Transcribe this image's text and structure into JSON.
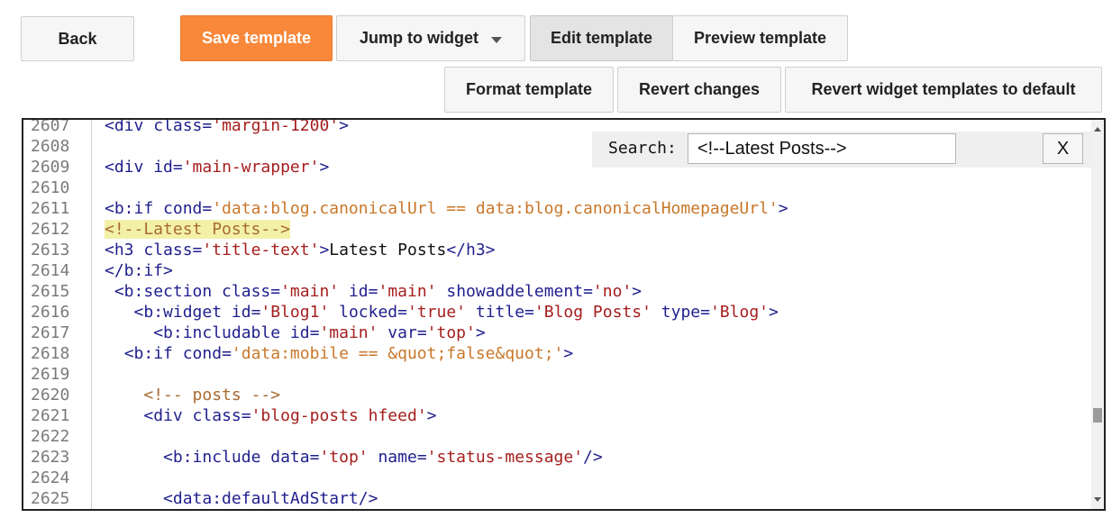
{
  "toolbar": {
    "back": "Back",
    "save": "Save template",
    "jump": "Jump to widget",
    "edit": "Edit template",
    "preview": "Preview template",
    "format": "Format template",
    "revert": "Revert changes",
    "revert_widgets": "Revert widget templates to default"
  },
  "search": {
    "label": "Search:",
    "value": "<!--Latest Posts-->",
    "close": "X"
  },
  "code": {
    "line_numbers": [
      "2607",
      "2608",
      "2609",
      "2610",
      "2611",
      "2612",
      "2613",
      "2614",
      "2615",
      "2616",
      "2617",
      "2618",
      "2619",
      "2620",
      "2621",
      "2622",
      "2623",
      "2624",
      "2625"
    ],
    "highlight_line": "2612",
    "tokens": {
      "l2607": [
        "<div",
        " class",
        "=",
        "'margin-1200'",
        ">"
      ],
      "l2609": [
        "<div",
        " id",
        "=",
        "'main-wrapper'",
        ">"
      ],
      "l2611": [
        "<b:if",
        " cond",
        "=",
        "'data:blog.canonicalUrl == data:blog.canonicalHomepageUrl'",
        ">"
      ],
      "l2612": [
        "<!--Latest Posts-->"
      ],
      "l2613": [
        "<h3",
        " class",
        "=",
        "'title-text'",
        ">",
        "Latest Posts",
        "</h3>"
      ],
      "l2614": [
        "</b:if>"
      ],
      "l2615": [
        " ",
        "<b:section",
        " class",
        "=",
        "'main'",
        " id",
        "=",
        "'main'",
        " showaddelement",
        "=",
        "'no'",
        ">"
      ],
      "l2616": [
        "   ",
        "<b:widget",
        " id",
        "=",
        "'Blog1'",
        " locked",
        "=",
        "'true'",
        " title",
        "=",
        "'Blog Posts'",
        " type",
        "=",
        "'Blog'",
        ">"
      ],
      "l2617": [
        "     ",
        "<b:includable",
        " id",
        "=",
        "'main'",
        " var",
        "=",
        "'top'",
        ">"
      ],
      "l2618": [
        "  ",
        "<b:if",
        " cond",
        "=",
        "'data:mobile == &quot;false&quot;'",
        ">"
      ],
      "l2620": [
        "    ",
        "<!-- posts -->"
      ],
      "l2621": [
        "    ",
        "<div",
        " class",
        "=",
        "'blog-posts hfeed'",
        ">"
      ],
      "l2623": [
        "      ",
        "<b:include",
        " data",
        "=",
        "'top'",
        " name",
        "=",
        "'status-message'",
        "/>"
      ],
      "l2625": [
        "      ",
        "<data:defaultAdStart/>"
      ]
    }
  }
}
